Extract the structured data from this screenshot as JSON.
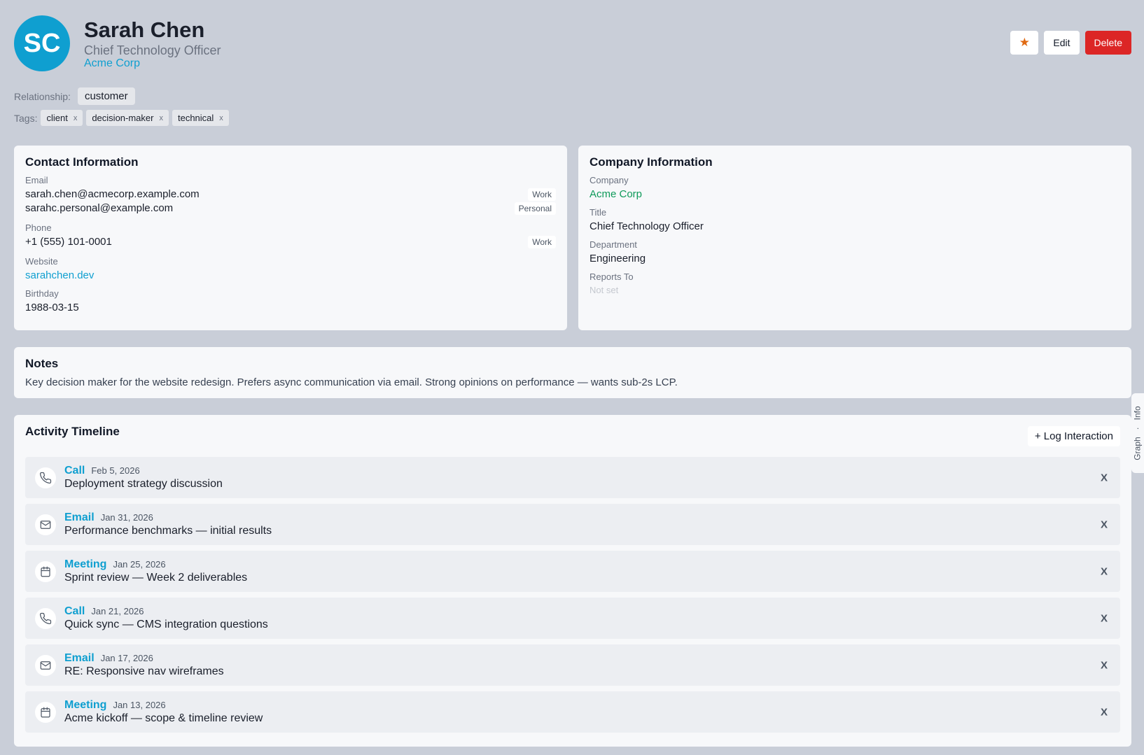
{
  "contact": {
    "initials": "SC",
    "name": "Sarah Chen",
    "title": "Chief Technology Officer",
    "company": "Acme Corp",
    "avatar_color": "#0f9fd0"
  },
  "actions": {
    "star_label": "★",
    "edit_label": "Edit",
    "delete_label": "Delete"
  },
  "relationship": {
    "label": "Relationship:",
    "value": "customer"
  },
  "tags": {
    "label": "Tags:",
    "remove_symbol": "x",
    "items": [
      "client",
      "decision-maker",
      "technical"
    ]
  },
  "contact_info": {
    "heading": "Contact Information",
    "email_label": "Email",
    "emails": [
      {
        "value": "sarah.chen@acmecorp.example.com",
        "kind": "Work"
      },
      {
        "value": "sarahc.personal@example.com",
        "kind": "Personal"
      }
    ],
    "phone_label": "Phone",
    "phone": {
      "value": "+1 (555) 101-0001",
      "kind": "Work"
    },
    "website_label": "Website",
    "website": "sarahchen.dev",
    "birthday_label": "Birthday",
    "birthday": "1988-03-15"
  },
  "company_info": {
    "heading": "Company Information",
    "company_label": "Company",
    "company": "Acme Corp",
    "title_label": "Title",
    "title": "Chief Technology Officer",
    "department_label": "Department",
    "department": "Engineering",
    "reports_to_label": "Reports To",
    "reports_to": "Not set"
  },
  "notes": {
    "heading": "Notes",
    "text": "Key decision maker for the website redesign. Prefers async communication via email. Strong opinions on performance — wants sub-2s LCP."
  },
  "timeline": {
    "heading": "Activity Timeline",
    "log_button": "+ Log Interaction",
    "remove_symbol": "X",
    "items": [
      {
        "type": "Call",
        "icon": "phone-icon",
        "date": "Feb 5, 2026",
        "description": "Deployment strategy discussion"
      },
      {
        "type": "Email",
        "icon": "mail-icon",
        "date": "Jan 31, 2026",
        "description": "Performance benchmarks — initial results"
      },
      {
        "type": "Meeting",
        "icon": "calendar-icon",
        "date": "Jan 25, 2026",
        "description": "Sprint review — Week 2 deliverables"
      },
      {
        "type": "Call",
        "icon": "phone-icon",
        "date": "Jan 21, 2026",
        "description": "Quick sync — CMS integration questions"
      },
      {
        "type": "Email",
        "icon": "mail-icon",
        "date": "Jan 17, 2026",
        "description": "RE: Responsive nav wireframes"
      },
      {
        "type": "Meeting",
        "icon": "calendar-icon",
        "date": "Jan 13, 2026",
        "description": "Acme kickoff — scope & timeline review"
      }
    ]
  },
  "side_tab": {
    "graph": "Graph",
    "separator": "·",
    "info": "Info"
  }
}
